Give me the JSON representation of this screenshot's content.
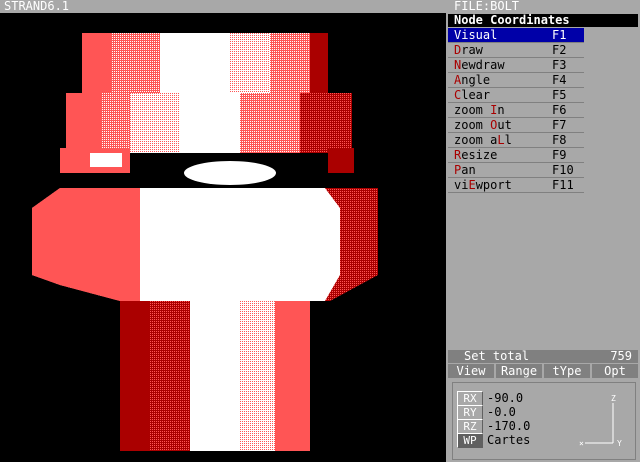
{
  "window": {
    "title": "STRAND6.1"
  },
  "panel": {
    "file_label": "FILE:BOLT",
    "mode_title": "Node Coordinates",
    "menu": [
      {
        "hotkey_prefix": "",
        "hotkey": "V",
        "rest": "isual",
        "key": "F1",
        "selected": true
      },
      {
        "hotkey_prefix": "",
        "hotkey": "D",
        "rest": "raw",
        "key": "F2"
      },
      {
        "hotkey_prefix": "",
        "hotkey": "N",
        "rest": "ewdraw",
        "key": "F3"
      },
      {
        "hotkey_prefix": "",
        "hotkey": "A",
        "rest": "ngle",
        "key": "F4"
      },
      {
        "hotkey_prefix": "",
        "hotkey": "C",
        "rest": "lear",
        "key": "F5"
      },
      {
        "hotkey_prefix": "zoom ",
        "hotkey": "I",
        "rest": "n",
        "key": "F6"
      },
      {
        "hotkey_prefix": "zoom ",
        "hotkey": "O",
        "rest": "ut",
        "key": "F7"
      },
      {
        "hotkey_prefix": "zoom a",
        "hotkey": "L",
        "rest": "l",
        "key": "F8"
      },
      {
        "hotkey_prefix": "",
        "hotkey": "R",
        "rest": "esize",
        "key": "F9"
      },
      {
        "hotkey_prefix": "",
        "hotkey": "P",
        "rest": "an",
        "key": "F10"
      },
      {
        "hotkey_prefix": "vi",
        "hotkey": "E",
        "rest": "wport",
        "key": "F11"
      }
    ],
    "set_total_label": "Set total",
    "set_total_value": "759",
    "tabs": [
      "View",
      "Range",
      "tYpe",
      "Opt"
    ],
    "coords": [
      {
        "btn": "RX",
        "value": "-90.0"
      },
      {
        "btn": "RY",
        "value": "-0.0"
      },
      {
        "btn": "RZ",
        "value": "-170.0"
      },
      {
        "btn": "WP",
        "value": "Cartes"
      }
    ],
    "axes": {
      "z": "Z",
      "y": "Y"
    }
  },
  "colors": {
    "bright_red": "#ff5555",
    "red": "#aa0000",
    "white": "#ffffff",
    "menu_bg": "#a8a8a8",
    "selected": "#0000a8"
  }
}
